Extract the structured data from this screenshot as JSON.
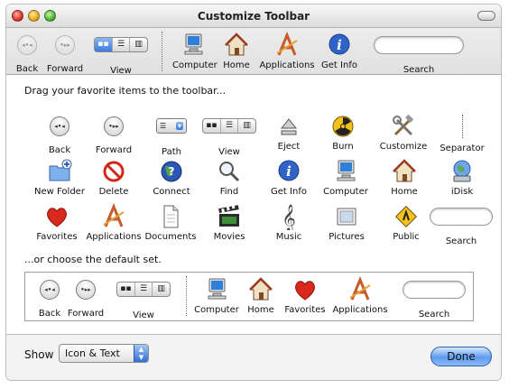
{
  "window": {
    "title": "Customize Toolbar"
  },
  "toolbar": {
    "back": "Back",
    "forward": "Forward",
    "view": "View",
    "computer": "Computer",
    "home": "Home",
    "applications": "Applications",
    "get_info": "Get Info",
    "search": "Search"
  },
  "palette": {
    "heading": "Drag your favorite items to the toolbar...",
    "row1": [
      "Back",
      "Forward",
      "Path",
      "View",
      "Eject",
      "Burn",
      "Customize",
      "Separator"
    ],
    "row2": [
      "New Folder",
      "Delete",
      "Connect",
      "Find",
      "Get Info",
      "Computer",
      "Home",
      "iDisk"
    ],
    "row3": [
      "Favorites",
      "Applications",
      "Documents",
      "Movies",
      "Music",
      "Pictures",
      "Public",
      "Search"
    ]
  },
  "default_set": {
    "heading": "...or choose the default set.",
    "back": "Back",
    "forward": "Forward",
    "view": "View",
    "computer": "Computer",
    "home": "Home",
    "favorites": "Favorites",
    "applications": "Applications",
    "search": "Search"
  },
  "footer": {
    "show_label": "Show",
    "show_value": "Icon & Text",
    "done": "Done"
  },
  "colors": {
    "aqua_blue": "#3a7be0",
    "done_button": "#5f9bf0"
  }
}
